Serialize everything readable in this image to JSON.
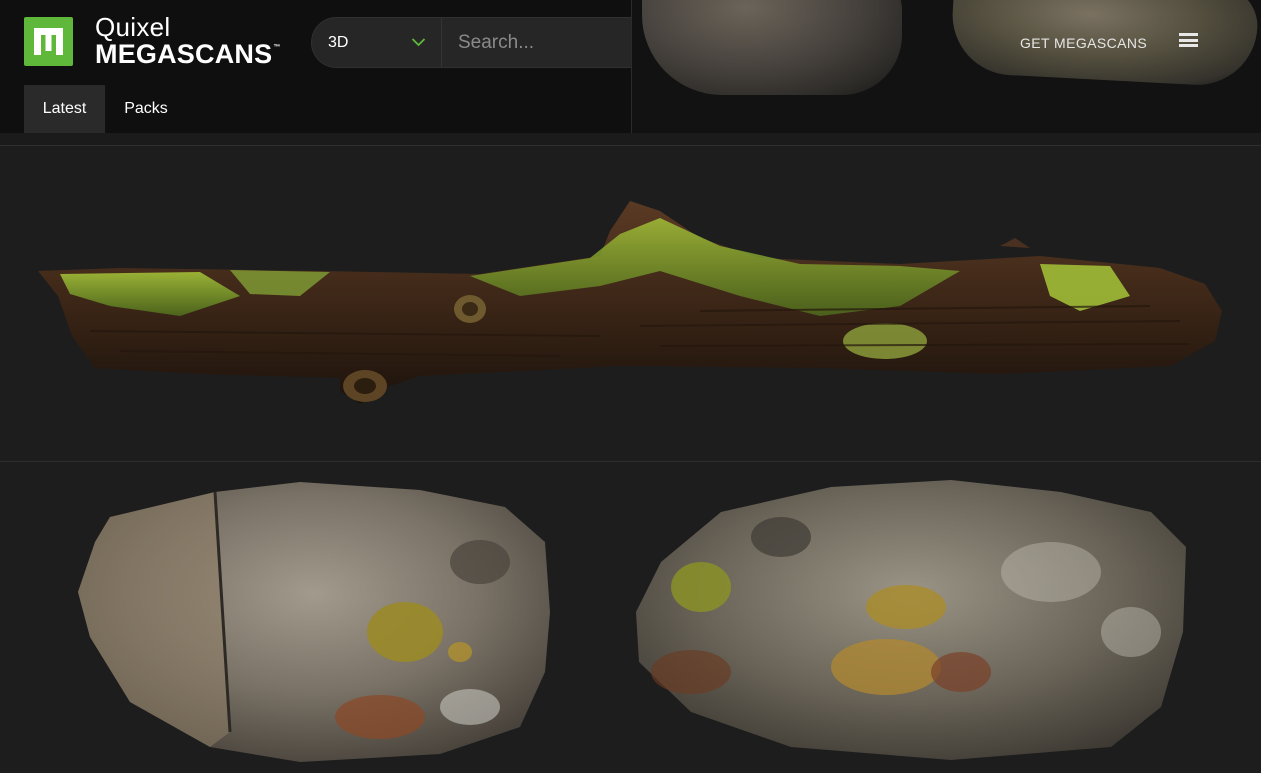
{
  "brand": {
    "line1": "Quixel",
    "line2": "MEGASCANS",
    "trademark": "™",
    "logo_letter_icon": "megascans-m-icon",
    "accent_color": "#5fb83a"
  },
  "search": {
    "type_value": "3D",
    "placeholder": "Search..."
  },
  "tabs": [
    {
      "label": "Latest",
      "active": true
    },
    {
      "label": "Packs",
      "active": false
    }
  ],
  "header_right": {
    "get_label": "GET MEGASCANS",
    "menu_icon": "hamburger-menu-icon"
  },
  "assets": [
    {
      "kind": "mossy-log"
    },
    {
      "kind": "rock"
    },
    {
      "kind": "rock"
    }
  ]
}
